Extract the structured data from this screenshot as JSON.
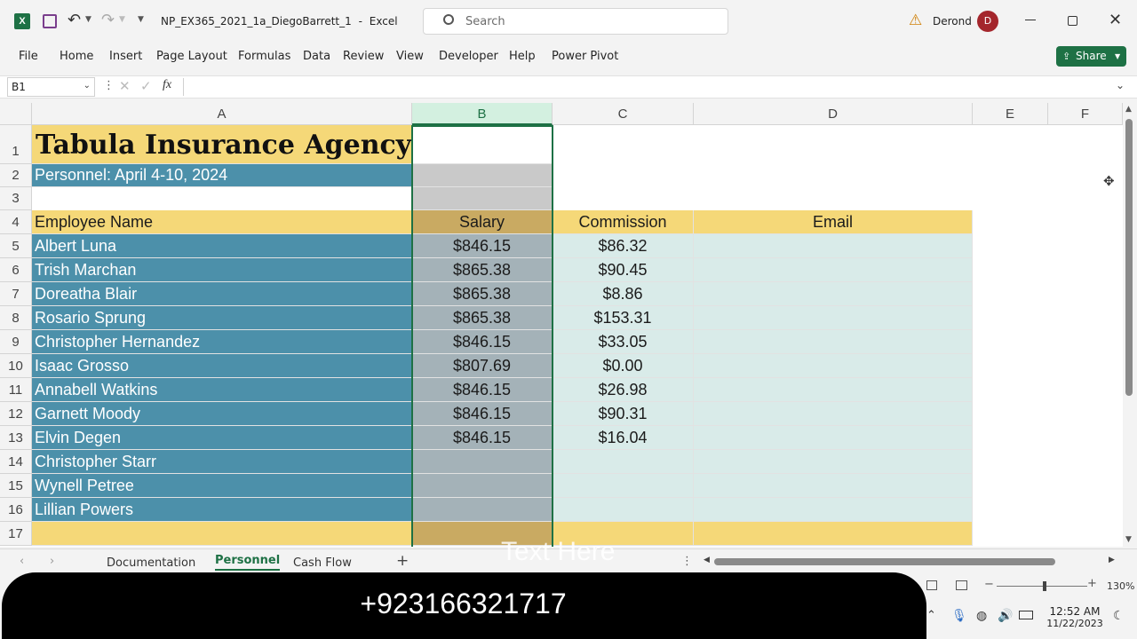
{
  "titlebar": {
    "filename": "NP_EX365_2021_1a_DiegoBarrett_1",
    "separator": "-",
    "app_name": "Excel",
    "search_placeholder": "Search",
    "user_name": "Derond",
    "avatar_initial": "D"
  },
  "menu": {
    "items": [
      "File",
      "Home",
      "Insert",
      "Page Layout",
      "Formulas",
      "Data",
      "Review",
      "View",
      "Developer",
      "Help",
      "Power Pivot"
    ],
    "share_label": "Share"
  },
  "formula_bar": {
    "name_box": "B1",
    "fx": "fx",
    "value": ""
  },
  "columns": [
    "A",
    "B",
    "C",
    "D",
    "E",
    "F"
  ],
  "rows": [
    "1",
    "2",
    "3",
    "4",
    "5",
    "6",
    "7",
    "8",
    "9",
    "10",
    "11",
    "12",
    "13",
    "14",
    "15",
    "16",
    "17"
  ],
  "sheet": {
    "title": "Tabula Insurance Agency",
    "subtitle": "Personnel: April 4-10, 2024",
    "headers": {
      "name": "Employee Name",
      "salary": "Salary",
      "commission": "Commission",
      "email": "Email"
    },
    "employees": [
      {
        "name": "Albert Luna",
        "salary": "$846.15",
        "commission": "$86.32"
      },
      {
        "name": "Trish Marchan",
        "salary": "$865.38",
        "commission": "$90.45"
      },
      {
        "name": "Doreatha Blair",
        "salary": "$865.38",
        "commission": "$8.86"
      },
      {
        "name": "Rosario Sprung",
        "salary": "$865.38",
        "commission": "$153.31"
      },
      {
        "name": "Christopher Hernandez",
        "salary": "$846.15",
        "commission": "$33.05"
      },
      {
        "name": "Isaac Grosso",
        "salary": "$807.69",
        "commission": "$0.00"
      },
      {
        "name": "Annabell Watkins",
        "salary": "$846.15",
        "commission": "$26.98"
      },
      {
        "name": "Garnett Moody",
        "salary": "$846.15",
        "commission": "$90.31"
      },
      {
        "name": "Elvin Degen",
        "salary": "$846.15",
        "commission": "$16.04"
      },
      {
        "name": "Christopher Starr",
        "salary": "",
        "commission": ""
      },
      {
        "name": "Wynell Petree",
        "salary": "",
        "commission": ""
      },
      {
        "name": "Lillian Powers",
        "salary": "",
        "commission": ""
      }
    ]
  },
  "tabs": [
    "Documentation",
    "Personnel",
    "Cash Flow"
  ],
  "status": {
    "zoom": "130%"
  },
  "overlay": {
    "watermark": "Text Here",
    "phone": "+923166321717"
  },
  "taskbar": {
    "time": "12:52 AM",
    "date": "11/22/2023"
  },
  "colors": {
    "teal": "#4c90aa",
    "gold": "#f5d878",
    "excel_green": "#1e7145"
  }
}
